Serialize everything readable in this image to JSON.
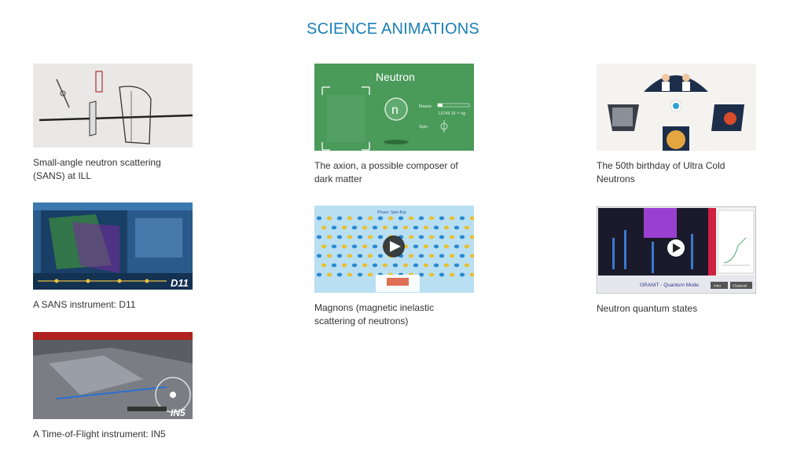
{
  "page": {
    "title": "SCIENCE ANIMATIONS"
  },
  "cards": [
    {
      "caption": "Small-angle neutron scattering (SANS) at ILL",
      "thumb_label": ""
    },
    {
      "caption": "The axion, a possible composer of dark matter",
      "thumb_label": "Neutron",
      "thumb_sub": [
        "Masse",
        "1,6749 10⁻²⁷ kg",
        "Spin"
      ]
    },
    {
      "caption": "The 50th birthday of Ultra Cold Neutrons",
      "thumb_label": ""
    },
    {
      "caption": "A SANS instrument: D11",
      "thumb_label": "D11"
    },
    {
      "caption": "Magnons (magnetic inelastic scattering of neutrons)",
      "thumb_label": "Phase: Spin-flop"
    },
    {
      "caption": "Neutron quantum states",
      "thumb_label": "GRANIT - Quantum Mode",
      "thumb_buttons": [
        "Intro",
        "Classical"
      ]
    },
    {
      "caption": "A Time-of-Flight instrument: IN5",
      "thumb_label": "IN5"
    }
  ],
  "colors": {
    "title": "#1a7fb5",
    "caption": "#333333",
    "neutron_green": "#4a9a5a",
    "play_button": "#222222"
  }
}
